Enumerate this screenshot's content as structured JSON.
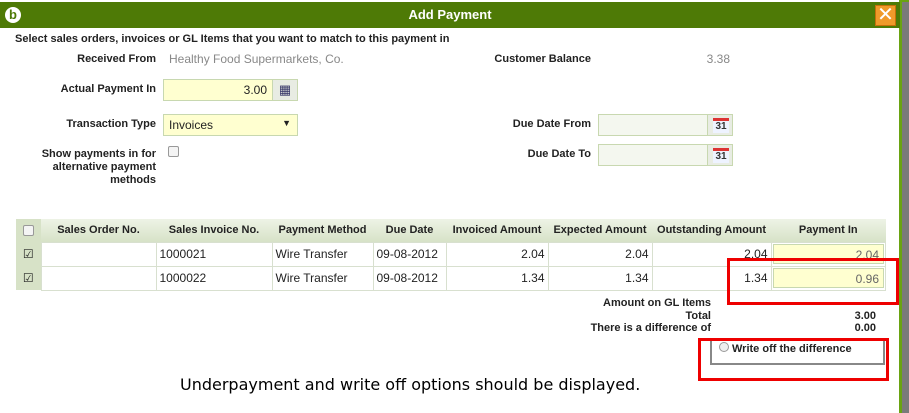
{
  "dialog": {
    "title": "Add Payment",
    "close": "✕",
    "logo": "b"
  },
  "instruction": "Select sales orders, invoices or GL Items that you want to match to this payment in",
  "form": {
    "received_from_label": "Received From",
    "received_from": "Healthy Food Supermarkets, Co.",
    "customer_balance_label": "Customer Balance",
    "customer_balance": "3.38",
    "actual_payment_label": "Actual Payment In",
    "actual_payment": "3.00",
    "transaction_type_label": "Transaction Type",
    "transaction_type": "Invoices",
    "due_from_label": "Due Date From",
    "due_to_label": "Due Date To",
    "calendar_day": "31",
    "show_alt_label": "Show payments in for alternative payment methods"
  },
  "table": {
    "headers": [
      "Sales Order No.",
      "Sales Invoice No.",
      "Payment Method",
      "Due Date",
      "Invoiced Amount",
      "Expected Amount",
      "Outstanding Amount",
      "Payment In"
    ],
    "rows": [
      {
        "checked": true,
        "order": "",
        "invoice": "1000021",
        "method": "Wire Transfer",
        "due": "09-08-2012",
        "invoiced": "2.04",
        "expected": "2.04",
        "outstanding": "2.04",
        "payment": "2.04"
      },
      {
        "checked": true,
        "order": "",
        "invoice": "1000022",
        "method": "Wire Transfer",
        "due": "09-08-2012",
        "invoiced": "1.34",
        "expected": "1.34",
        "outstanding": "1.34",
        "payment": "0.96"
      }
    ]
  },
  "summary": {
    "gl_label": "Amount on GL Items",
    "total_label": "Total",
    "total": "3.00",
    "diff_label": "There is a difference of",
    "diff": "0.00",
    "writeoff_label": "Write off the difference"
  },
  "annotation": "Underpayment and write off options should be displayed."
}
